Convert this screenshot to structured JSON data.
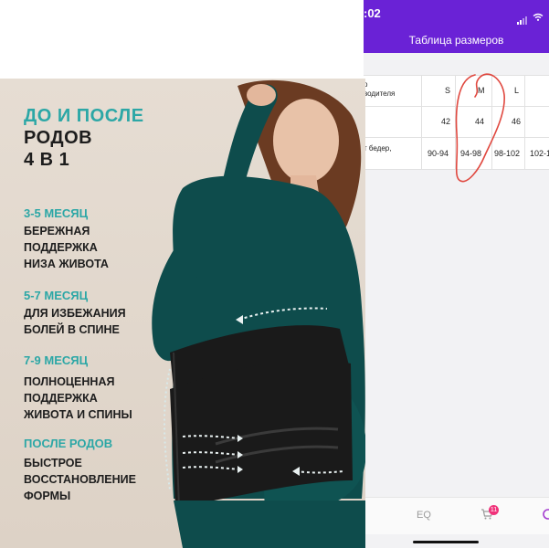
{
  "phone": {
    "status_time": ":02",
    "header_title": "Таблица размеров",
    "table": {
      "row_labels": [
        "р\nводителя",
        "",
        "т бедер,"
      ],
      "columns": [
        "S",
        "M",
        "L"
      ],
      "row_size": [
        "42",
        "44",
        "46"
      ],
      "row_hips": [
        "90-94",
        "94-98",
        "98-102",
        "102-1"
      ]
    },
    "cart_count": "11",
    "nav_eq_label": "EQ"
  },
  "banner": {
    "title_line1": "ДО И ПОСЛЕ",
    "title_line2": "РОДОВ",
    "title_line3": "4 В 1",
    "stages": [
      {
        "label": "3-5 МЕСЯЦ",
        "desc": [
          "БЕРЕЖНАЯ",
          "ПОДДЕРЖКА",
          "НИЗА ЖИВОТА"
        ]
      },
      {
        "label": "5-7 МЕСЯЦ",
        "desc": [
          "ДЛЯ ИЗБЕЖАНИЯ",
          "БОЛЕЙ В СПИНЕ"
        ]
      },
      {
        "label": "7-9 МЕСЯЦ",
        "desc": [
          "ПОЛНОЦЕННАЯ",
          "ПОДДЕРЖКА",
          "ЖИВОТА И СПИНЫ"
        ]
      },
      {
        "label": "ПОСЛЕ РОДОВ",
        "desc": [
          "БЫСТРОЕ",
          "ВОССТАНОВЛЕНИЕ",
          "ФОРМЫ"
        ]
      }
    ],
    "colors": {
      "accent": "#2ca7a6",
      "text": "#1d1d1d",
      "background": "#e2d8cc",
      "top_wear": "#0e4c4c",
      "belt": "#1a1a1a"
    }
  },
  "icons": [
    "signal-icon",
    "wifi-icon",
    "cart-icon",
    "eq-icon",
    "profile-icon",
    "arrow-icon"
  ]
}
